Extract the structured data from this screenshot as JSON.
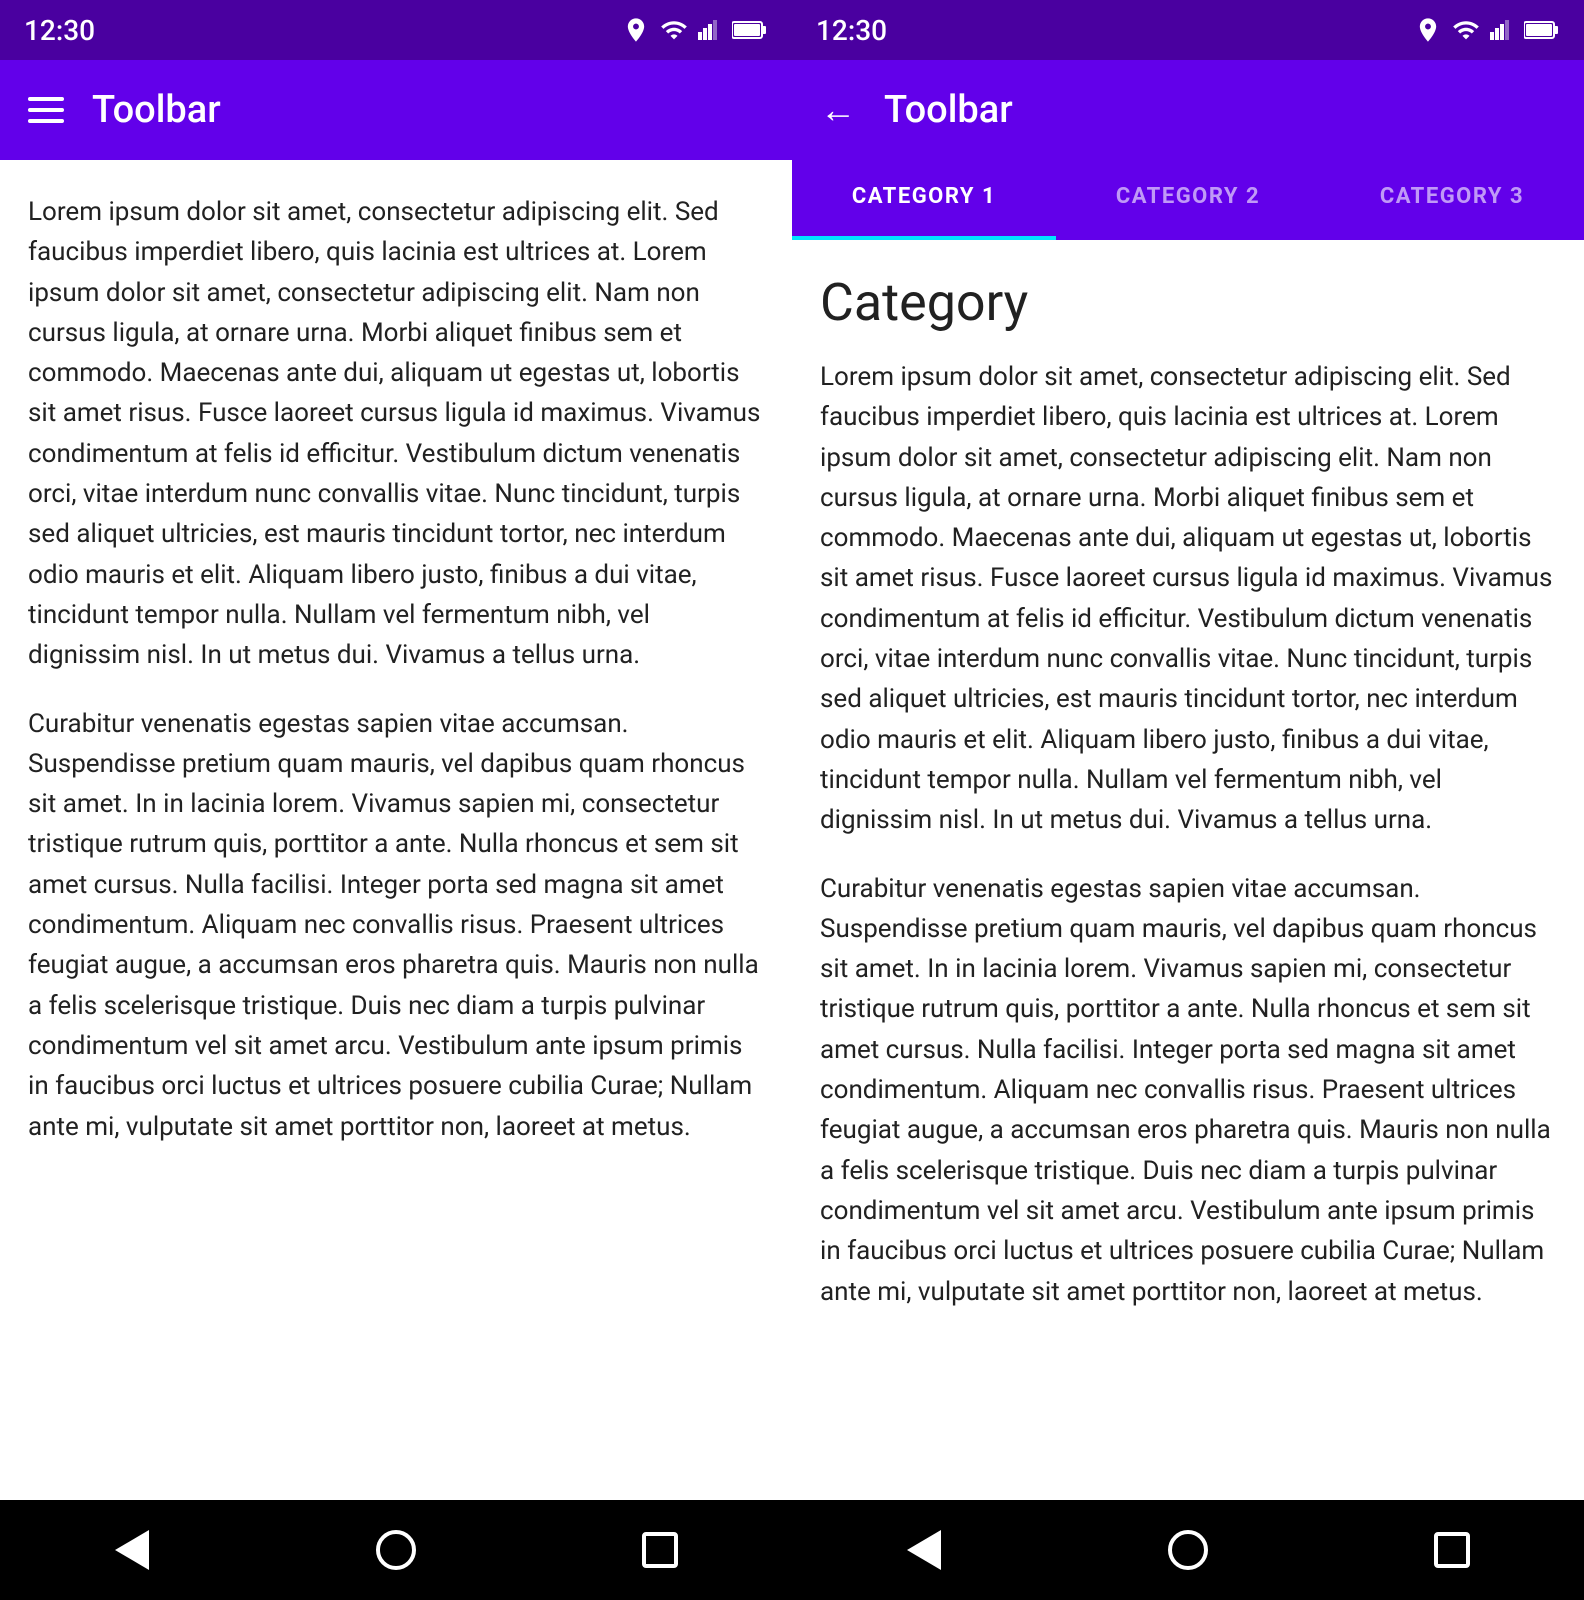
{
  "left_phone": {
    "status_bar": {
      "time": "12:30"
    },
    "toolbar": {
      "title": "Toolbar"
    },
    "content": {
      "paragraph1": "Lorem ipsum dolor sit amet, consectetur adipiscing elit. Sed faucibus imperdiet libero, quis lacinia est ultrices at. Lorem ipsum dolor sit amet, consectetur adipiscing elit. Nam non cursus ligula, at ornare urna. Morbi aliquet finibus sem et commodo. Maecenas ante dui, aliquam ut egestas ut, lobortis sit amet risus. Fusce laoreet cursus ligula id maximus. Vivamus condimentum at felis id efficitur. Vestibulum dictum venenatis orci, vitae interdum nunc convallis vitae. Nunc tincidunt, turpis sed aliquet ultricies, est mauris tincidunt tortor, nec interdum odio mauris et elit. Aliquam libero justo, finibus a dui vitae, tincidunt tempor nulla. Nullam vel fermentum nibh, vel dignissim nisl. In ut metus dui. Vivamus a tellus urna.",
      "paragraph2": "Curabitur venenatis egestas sapien vitae accumsan. Suspendisse pretium quam mauris, vel dapibus quam rhoncus sit amet. In in lacinia lorem. Vivamus sapien mi, consectetur tristique rutrum quis, porttitor a ante. Nulla rhoncus et sem sit amet cursus. Nulla facilisi. Integer porta sed magna sit amet condimentum. Aliquam nec convallis risus. Praesent ultrices feugiat augue, a accumsan eros pharetra quis. Mauris non nulla a felis scelerisque tristique. Duis nec diam a turpis pulvinar condimentum vel sit amet arcu. Vestibulum ante ipsum primis in faucibus orci luctus et ultrices posuere cubilia Curae; Nullam ante mi, vulputate sit amet porttitor non, laoreet at metus."
    },
    "nav": {
      "back_label": "back",
      "home_label": "home",
      "recent_label": "recent"
    }
  },
  "right_phone": {
    "status_bar": {
      "time": "12:30"
    },
    "toolbar": {
      "title": "Toolbar"
    },
    "tabs": [
      {
        "label": "CATEGORY 1",
        "active": true
      },
      {
        "label": "CATEGORY 2",
        "active": false
      },
      {
        "label": "CATEGORY 3",
        "active": false
      }
    ],
    "content": {
      "category_title": "Category",
      "paragraph1": "Lorem ipsum dolor sit amet, consectetur adipiscing elit. Sed faucibus imperdiet libero, quis lacinia est ultrices at. Lorem ipsum dolor sit amet, consectetur adipiscing elit. Nam non cursus ligula, at ornare urna. Morbi aliquet finibus sem et commodo. Maecenas ante dui, aliquam ut egestas ut, lobortis sit amet risus. Fusce laoreet cursus ligula id maximus. Vivamus condimentum at felis id efficitur. Vestibulum dictum venenatis orci, vitae interdum nunc convallis vitae. Nunc tincidunt, turpis sed aliquet ultricies, est mauris tincidunt tortor, nec interdum odio mauris et elit. Aliquam libero justo, finibus a dui vitae, tincidunt tempor nulla. Nullam vel fermentum nibh, vel dignissim nisl. In ut metus dui. Vivamus a tellus urna.",
      "paragraph2": "Curabitur venenatis egestas sapien vitae accumsan. Suspendisse pretium quam mauris, vel dapibus quam rhoncus sit amet. In in lacinia lorem. Vivamus sapien mi, consectetur tristique rutrum quis, porttitor a ante. Nulla rhoncus et sem sit amet cursus. Nulla facilisi. Integer porta sed magna sit amet condimentum. Aliquam nec convallis risus. Praesent ultrices feugiat augue, a accumsan eros pharetra quis. Mauris non nulla a felis scelerisque tristique. Duis nec diam a turpis pulvinar condimentum vel sit amet arcu. Vestibulum ante ipsum primis in faucibus orci luctus et ultrices posuere cubilia Curae; Nullam ante mi, vulputate sit amet porttitor non, laoreet at metus."
    },
    "nav": {
      "back_label": "back",
      "home_label": "home",
      "recent_label": "recent"
    }
  }
}
